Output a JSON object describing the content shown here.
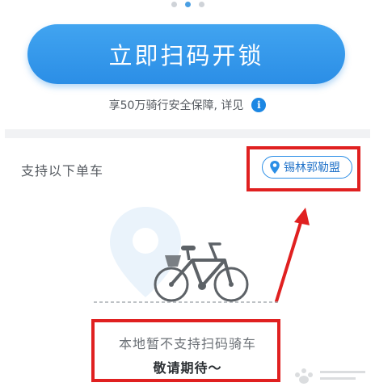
{
  "pager": {
    "count": 3,
    "active_index": 1
  },
  "scan_button": {
    "label": "立即扫码开锁",
    "color": "#2b8ee6"
  },
  "insurance": {
    "text": "享50万骑行安全保障, 详见",
    "info_icon": "info-icon"
  },
  "support": {
    "label": "支持以下单车"
  },
  "city": {
    "name": "锡林郭勒盟",
    "icon": "location-pin-icon"
  },
  "illustration": {
    "icon": "bicycle-icon"
  },
  "message": {
    "line1": "本地暂不支持扫码骑车",
    "line2": "敬请期待～"
  },
  "colors": {
    "accent": "#2b8ee6",
    "annotation": "#e02020"
  }
}
